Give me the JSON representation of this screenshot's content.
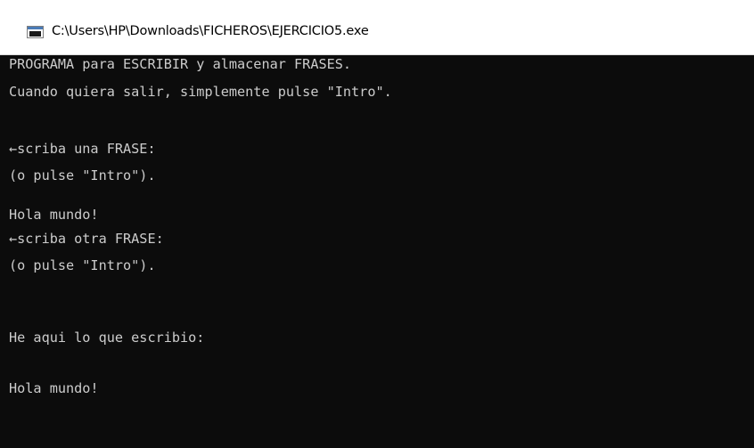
{
  "window": {
    "title": "C:\\Users\\HP\\Downloads\\FICHEROS\\EJERCICIO5.exe",
    "icon": "console-app-icon"
  },
  "console": {
    "lines": [
      "PROGRAMA para ESCRIBIR y almacenar FRASES.",
      "Cuando quiera salir, simplemente pulse \"Intro\".",
      "",
      "←scriba una FRASE:",
      "(o pulse \"Intro\").",
      "",
      "Hola mundo!",
      "←scriba otra FRASE:",
      "(o pulse \"Intro\").",
      "",
      "",
      "He aqui lo que escribio:",
      "",
      "Hola mundo!"
    ]
  },
  "colors": {
    "console_background": "#0c0c0c",
    "console_text": "#cccccc",
    "titlebar_background": "#ffffff"
  }
}
